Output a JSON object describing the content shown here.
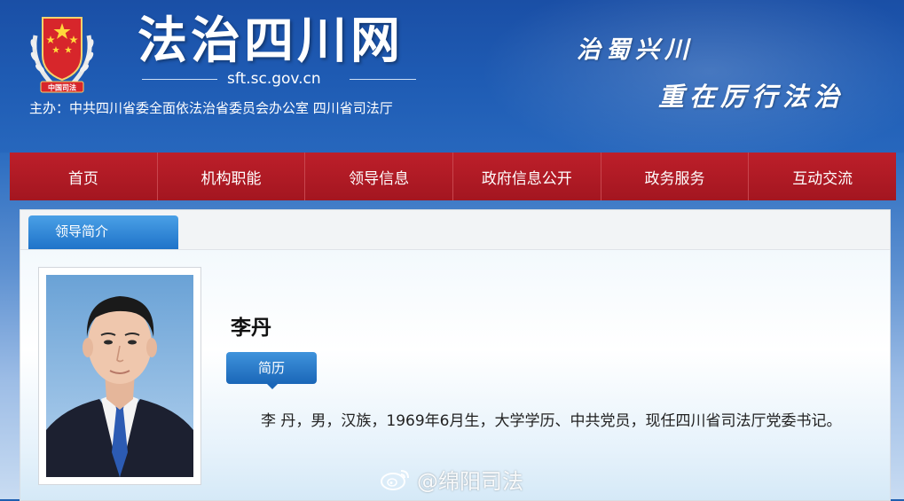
{
  "header": {
    "emblem_text": "中国司法",
    "site_title": "法治四川网",
    "domain": "sft.sc.gov.cn",
    "sponsor": "主办：中共四川省委全面依法治省委员会办公室    四川省司法厅",
    "slogan_line1": "治蜀兴川",
    "slogan_line2": "重在厉行法治"
  },
  "nav": {
    "items": [
      {
        "label": "首页"
      },
      {
        "label": "机构职能"
      },
      {
        "label": "领导信息"
      },
      {
        "label": "政府信息公开"
      },
      {
        "label": "政务服务"
      },
      {
        "label": "互动交流"
      }
    ]
  },
  "main": {
    "tab_label": "领导简介",
    "person_name": "李丹",
    "resume_button": "简历",
    "bio": "李  丹，男，汉族，1969年6月生，大学学历、中共党员，现任四川省司法厅党委书记。"
  },
  "watermark": {
    "text": "@绵阳司法"
  },
  "colors": {
    "header_blue": "#1f5cb4",
    "nav_red": "#b01c26",
    "tab_blue": "#2a80d4"
  }
}
